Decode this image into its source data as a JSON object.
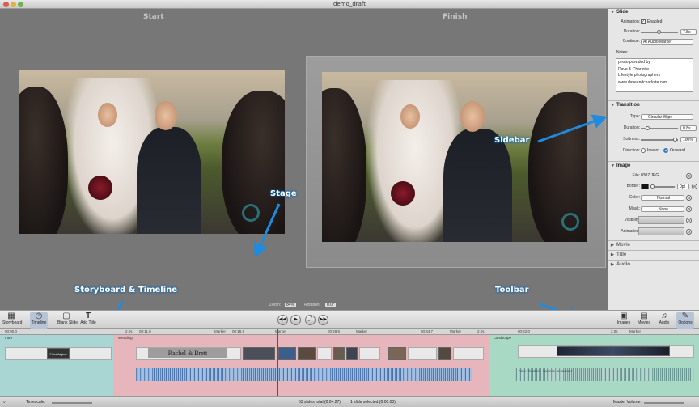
{
  "window": {
    "title": "demo_draft"
  },
  "stage": {
    "start_label": "Start",
    "finish_label": "Finish",
    "zoom_label": "Zoom:",
    "zoom_value": "84%",
    "rotation_label": "Rotation:",
    "rotation_value": "0.0°"
  },
  "sidebar": {
    "slide": {
      "header": "Slide",
      "animation_label": "Animation:",
      "animation_enabled_label": "Enabled",
      "duration_label": "Duration:",
      "duration_value": "7.5s",
      "continue_label": "Continue:",
      "continue_value": "At Audio Marker",
      "notes_label": "Notes:",
      "notes_lines": [
        "photo provided by",
        "",
        "Dave & Charlotte",
        "Lifestyle photographers",
        "",
        "www.daveandcharlotte.com"
      ]
    },
    "transition": {
      "header": "Transition",
      "type_label": "Type:",
      "type_value": "Circular Wipe",
      "duration_label": "Duration:",
      "duration_value": "0.8s",
      "softness_label": "Softness:",
      "softness_value": "100%",
      "direction_label": "Direction:",
      "direction_inward": "Inward",
      "direction_outward": "Outward"
    },
    "image": {
      "header": "Image",
      "file_label": "File:",
      "file_value": "0307.JPG",
      "border_label": "Border:",
      "border_value": "0pt",
      "color_label": "Color:",
      "color_value": "Normal",
      "mask_label": "Mask:",
      "mask_value": "None",
      "visibility_label": "Visibility:",
      "animation_label": "Animation:"
    },
    "collapsed": [
      "Movie",
      "Title",
      "Audio"
    ]
  },
  "callouts": {
    "stage": "Stage",
    "sidebar": "Sidebar",
    "storyboard": "Storyboard & Timeline",
    "toolbar": "Toolbar"
  },
  "toolbar": {
    "storyboard": "Storyboard",
    "timeline": "Timeline",
    "blank_slide": "Blank Slide",
    "add_title": "Add Title",
    "images": "Images",
    "movies": "Movies",
    "audio": "Audio",
    "options": "Options"
  },
  "timeline": {
    "ruler": [
      "00:00.0",
      "2.0s",
      "00:11.0",
      "Marker",
      "00:18.9",
      "Marker",
      "00:28.6",
      "Marker",
      "00:34.7",
      "Marker",
      "2.0s",
      "00:42.0",
      "2.0s",
      "Marker"
    ],
    "segments": [
      "Intro",
      "Wedding",
      "Landscape"
    ],
    "title_slide_text": "Rachel & Brett",
    "intro_thumb_text": "FotoMagico",
    "audio_label": "Alex Khaskin - Sunrise on sunset",
    "audio_strip_label": "1 0:00"
  },
  "statusbar": {
    "timescale_label": "Timescale:",
    "summary": "63 slides total (0:04:27)",
    "selected": "1 slide selected (0:00:03)",
    "master_volume_label": "Master Volume:"
  },
  "colors": {
    "callout_blue": "#1f8be0",
    "intro_segment": "#a9d6d2",
    "wedding_segment": "#e7b6bd",
    "landscape_segment": "#a8d9c4",
    "audio_wave": "#4d7fb8"
  }
}
